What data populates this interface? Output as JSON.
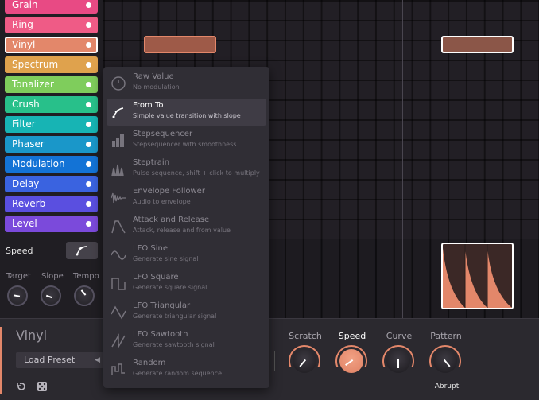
{
  "effects": {
    "items": [
      {
        "label": "Grain",
        "color": "#e84a84"
      },
      {
        "label": "Ring",
        "color": "#ef5b86"
      },
      {
        "label": "Vinyl",
        "color": "#e3876a",
        "selected": true
      },
      {
        "label": "Spectrum",
        "color": "#dfa24d"
      },
      {
        "label": "Tonalizer",
        "color": "#7fcd5c"
      },
      {
        "label": "Crush",
        "color": "#28c08a"
      },
      {
        "label": "Filter",
        "color": "#17b4b4"
      },
      {
        "label": "Phaser",
        "color": "#1a97c9"
      },
      {
        "label": "Modulation",
        "color": "#1373d6"
      },
      {
        "label": "Delay",
        "color": "#3a63e0"
      },
      {
        "label": "Reverb",
        "color": "#5a4fe0"
      },
      {
        "label": "Level",
        "color": "#7b4adb"
      }
    ]
  },
  "modulation": {
    "speed_label": "Speed",
    "knobs": [
      "Target",
      "Slope",
      "Tempo"
    ]
  },
  "menu": {
    "items": [
      {
        "title": "Raw Value",
        "subtitle": "No modulation",
        "icon": "raw-value-icon"
      },
      {
        "title": "From To",
        "subtitle": "Simple value transition with slope",
        "icon": "from-to-icon",
        "highlighted": true
      },
      {
        "title": "Stepsequencer",
        "subtitle": "Stepsequencer with smoothness",
        "icon": "stepsequencer-icon"
      },
      {
        "title": "Steptrain",
        "subtitle": "Pulse sequence, shift + click to multiply",
        "icon": "steptrain-icon"
      },
      {
        "title": "Envelope Follower",
        "subtitle": "Audio to envelope",
        "icon": "envelope-follower-icon"
      },
      {
        "title": "Attack and Release",
        "subtitle": "Attack, release and from value",
        "icon": "attack-release-icon"
      },
      {
        "title": "LFO Sine",
        "subtitle": "Generate sine signal",
        "icon": "lfo-sine-icon"
      },
      {
        "title": "LFO Square",
        "subtitle": "Generate square signal",
        "icon": "lfo-square-icon"
      },
      {
        "title": "LFO Triangular",
        "subtitle": "Generate triangular signal",
        "icon": "lfo-triangular-icon"
      },
      {
        "title": "LFO Sawtooth",
        "subtitle": "Generate sawtooth signal",
        "icon": "lfo-sawtooth-icon"
      },
      {
        "title": "Random",
        "subtitle": "Generate random sequence",
        "icon": "random-icon"
      }
    ]
  },
  "bottom": {
    "preset_title": "Vinyl",
    "load_preset": "Load Preset",
    "knobs": [
      {
        "label": "Scratch",
        "active": false
      },
      {
        "label": "Speed",
        "active": true
      },
      {
        "label": "Curve",
        "active": false
      },
      {
        "label": "Pattern",
        "active": false
      }
    ],
    "pattern_value": "Abrupt"
  },
  "colors": {
    "accent": "#e3876a",
    "background": "#201e23",
    "menu_bg": "#302e35"
  }
}
